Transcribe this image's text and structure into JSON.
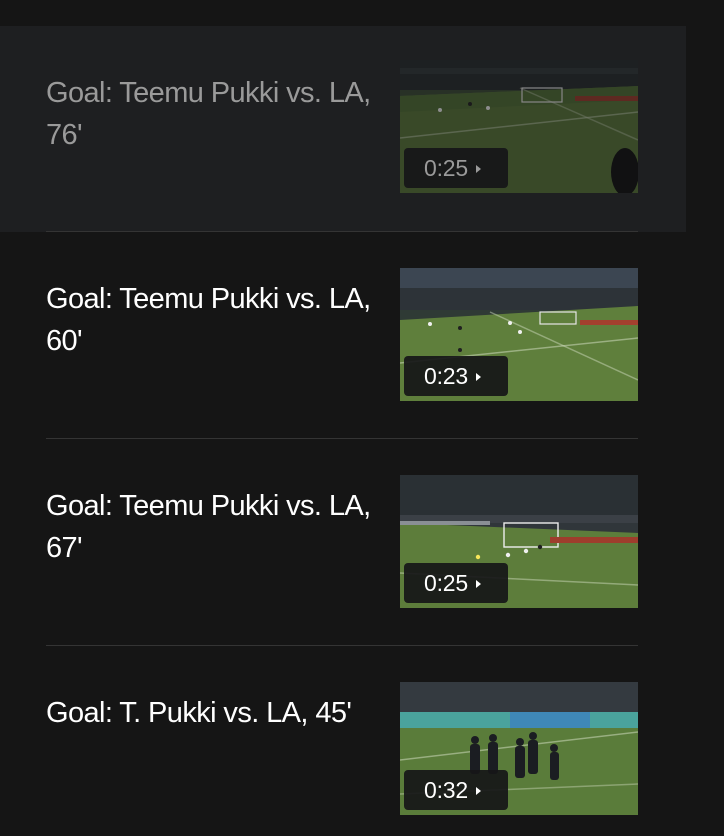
{
  "videos": [
    {
      "title": "Goal: Teemu Pukki vs. LA, 76'",
      "duration": "0:25",
      "active": true,
      "thumbnail_icon": "soccer-field-thumbnail"
    },
    {
      "title": "Goal: Teemu Pukki vs. LA, 60'",
      "duration": "0:23",
      "active": false,
      "thumbnail_icon": "soccer-field-thumbnail"
    },
    {
      "title": "Goal: Teemu Pukki vs. LA, 67'",
      "duration": "0:25",
      "active": false,
      "thumbnail_icon": "soccer-field-thumbnail"
    },
    {
      "title": "Goal: T. Pukki vs. LA, 45'",
      "duration": "0:32",
      "active": false,
      "thumbnail_icon": "soccer-celebration-thumbnail"
    }
  ],
  "colors": {
    "background": "#151515",
    "active_background": "#1e1f21",
    "title": "#ffffff",
    "active_title": "#9a9a9a",
    "divider": "#343434",
    "pitch": "#5c7a3a",
    "stands": "#2c2f33"
  }
}
